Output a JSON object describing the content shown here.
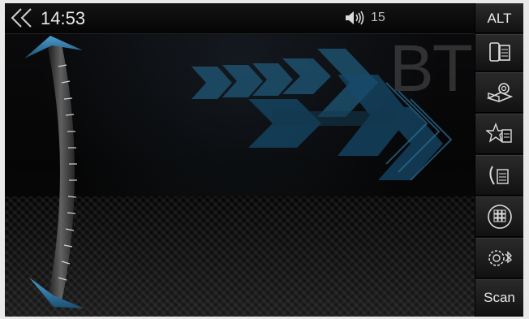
{
  "status_bar": {
    "back_icon": "double-chevron-left-icon",
    "time": "14:53",
    "volume_icon": "speaker-icon",
    "volume_level": "15"
  },
  "main": {
    "watermark": "BT",
    "scroll_slider": {
      "top_arrow": "up-arrow-icon",
      "bottom_arrow": "down-arrow-icon"
    }
  },
  "sidebar": {
    "alt_label": "ALT",
    "items": [
      {
        "name": "phone-list-icon"
      },
      {
        "name": "contacts-book-icon"
      },
      {
        "name": "favorites-icon"
      },
      {
        "name": "call-log-icon"
      },
      {
        "name": "dialpad-icon"
      },
      {
        "name": "bt-settings-icon"
      }
    ],
    "scan_label": "Scan"
  },
  "colors": {
    "accent_blue": "#2d6f96",
    "background": "#000000",
    "text": "#e8e8e8"
  }
}
